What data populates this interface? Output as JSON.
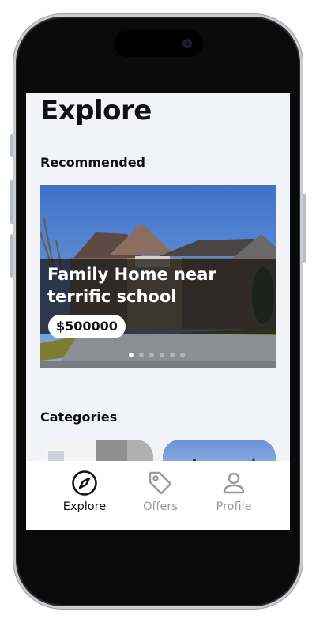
{
  "page": {
    "title": "Explore"
  },
  "sections": {
    "recommended": "Recommended",
    "categories": "Categories"
  },
  "recommended": [
    {
      "title": "Family Home near terrific school",
      "price": "$500000"
    }
  ],
  "carousel": {
    "count": 6,
    "active_index": 0
  },
  "tabbar": {
    "items": [
      {
        "label": "Explore",
        "icon": "compass-icon",
        "active": true
      },
      {
        "label": "Offers",
        "icon": "tag-icon",
        "active": false
      },
      {
        "label": "Profile",
        "icon": "user-icon",
        "active": false
      }
    ]
  },
  "colors": {
    "active_tab": "#111111",
    "inactive_tab": "#9a9a9a",
    "background": "#f2f3f7"
  }
}
